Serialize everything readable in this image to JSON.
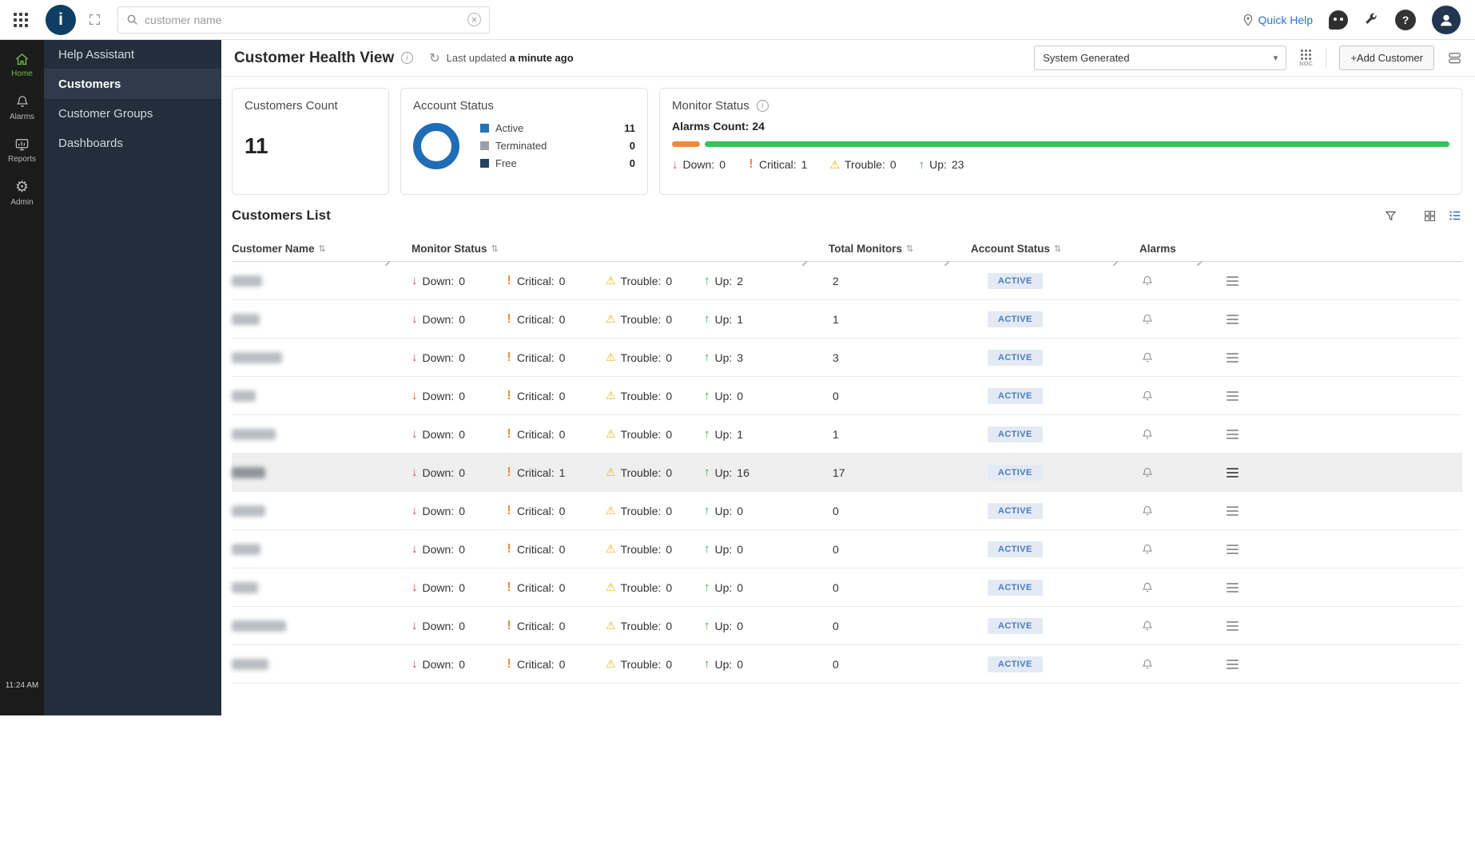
{
  "topbar": {
    "search_placeholder": "customer name",
    "quick_help": "Quick Help"
  },
  "sidebar": {
    "items": [
      {
        "label": "Home"
      },
      {
        "label": "Alarms"
      },
      {
        "label": "Reports"
      },
      {
        "label": "Admin"
      }
    ],
    "time": "11:24 AM"
  },
  "nav": {
    "items": [
      "Help Assistant",
      "Customers",
      "Customer Groups",
      "Dashboards"
    ]
  },
  "header": {
    "title": "Customer Health View",
    "last_updated_prefix": "Last updated",
    "last_updated_value": "a minute ago",
    "view_selector": "System Generated",
    "noc_label": "NOC",
    "add_customer": "+Add Customer"
  },
  "cards": {
    "customers_count": {
      "title": "Customers Count",
      "value": "11"
    },
    "account_status": {
      "title": "Account Status",
      "legend": [
        {
          "label": "Active",
          "value": "11",
          "color": "#2373bb"
        },
        {
          "label": "Terminated",
          "value": "0",
          "color": "#9aa0a6"
        },
        {
          "label": "Free",
          "value": "0",
          "color": "#27415f"
        }
      ]
    },
    "monitor_status": {
      "title": "Monitor Status",
      "alarms_count_label": "Alarms Count:",
      "alarms_count": "24",
      "down_label": "Down:",
      "down": "0",
      "critical_label": "Critical:",
      "critical": "1",
      "trouble_label": "Trouble:",
      "trouble": "0",
      "up_label": "Up:",
      "up": "23"
    }
  },
  "table": {
    "title": "Customers List",
    "columns": [
      "Customer Name",
      "Monitor Status",
      "Total Monitors",
      "Account Status",
      "Alarms"
    ],
    "cell_labels": {
      "down": "Down:",
      "critical": "Critical:",
      "trouble": "Trouble:",
      "up": "Up:"
    },
    "rows": [
      {
        "down": "0",
        "critical": "0",
        "trouble": "0",
        "up": "2",
        "total": "2",
        "status": "ACTIVE",
        "highlighted": false,
        "name_width": 38
      },
      {
        "down": "0",
        "critical": "0",
        "trouble": "0",
        "up": "1",
        "total": "1",
        "status": "ACTIVE",
        "highlighted": false,
        "name_width": 35
      },
      {
        "down": "0",
        "critical": "0",
        "trouble": "0",
        "up": "3",
        "total": "3",
        "status": "ACTIVE",
        "highlighted": false,
        "name_width": 63
      },
      {
        "down": "0",
        "critical": "0",
        "trouble": "0",
        "up": "0",
        "total": "0",
        "status": "ACTIVE",
        "highlighted": false,
        "name_width": 30
      },
      {
        "down": "0",
        "critical": "0",
        "trouble": "0",
        "up": "1",
        "total": "1",
        "status": "ACTIVE",
        "highlighted": false,
        "name_width": 55
      },
      {
        "down": "0",
        "critical": "1",
        "trouble": "0",
        "up": "16",
        "total": "17",
        "status": "ACTIVE",
        "highlighted": true,
        "name_width": 42
      },
      {
        "down": "0",
        "critical": "0",
        "trouble": "0",
        "up": "0",
        "total": "0",
        "status": "ACTIVE",
        "highlighted": false,
        "name_width": 42
      },
      {
        "down": "0",
        "critical": "0",
        "trouble": "0",
        "up": "0",
        "total": "0",
        "status": "ACTIVE",
        "highlighted": false,
        "name_width": 36
      },
      {
        "down": "0",
        "critical": "0",
        "trouble": "0",
        "up": "0",
        "total": "0",
        "status": "ACTIVE",
        "highlighted": false,
        "name_width": 33
      },
      {
        "down": "0",
        "critical": "0",
        "trouble": "0",
        "up": "0",
        "total": "0",
        "status": "ACTIVE",
        "highlighted": false,
        "name_width": 68
      },
      {
        "down": "0",
        "critical": "0",
        "trouble": "0",
        "up": "0",
        "total": "0",
        "status": "ACTIVE",
        "highlighted": false,
        "name_width": 46
      }
    ]
  },
  "icons": {
    "info": "i",
    "refresh": "↻",
    "caret_down": "▾",
    "sort": "⇅",
    "down_arrow": "↓",
    "up_arrow": "↑",
    "critical_bang": "!",
    "trouble_warn": "⚠",
    "question": "?",
    "clear": "×"
  },
  "colors": {
    "accent_blue": "#2272b9",
    "link_blue": "#2f6fd0",
    "green": "#2fae4e",
    "bright_green": "#35c35b",
    "red": "#d9453a",
    "orange": "#f08a3c",
    "amber": "#f0b41f",
    "badge_bg": "#e3eaf4",
    "badge_text": "#4a7cc0",
    "sidebar_green": "#6dbe45",
    "rail_bg": "#1b1b1b",
    "subnav_bg": "#232e3c",
    "subnav_active_bg": "#2f3b4b",
    "donut_blue": "#1f6cb7"
  }
}
